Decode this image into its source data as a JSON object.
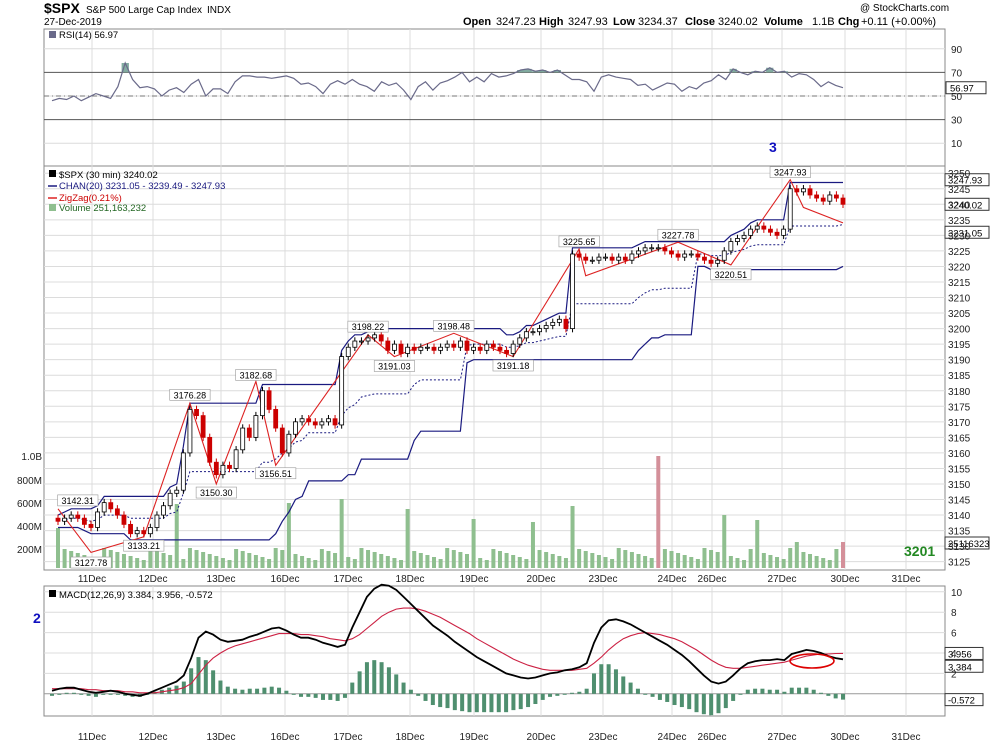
{
  "header": {
    "symbol": "$SPX",
    "name": "S&P 500 Large Cap Index",
    "exchange": "INDX",
    "date": "27-Dec-2019",
    "watermark": "@ StockCharts.com",
    "open_label": "Open",
    "open": "3247.23",
    "high_label": "High",
    "high": "3247.93",
    "low_label": "Low",
    "low": "3234.37",
    "close_label": "Close",
    "close": "3240.02",
    "volume_label": "Volume",
    "volume": "1.1B",
    "chg_label": "Chg",
    "chg": "+0.11 (+0.00%)"
  },
  "colors": {
    "up": "#000000",
    "down": "#cc0000",
    "channel": "#1a1a80",
    "zigzag": "#dd2222",
    "volume_bar": "#8fbf8f",
    "volume_bar_red": "#d4909a",
    "rsi_line": "#6a6a8a",
    "rsi_fill": "#6d9e90",
    "macd_line": "#000000",
    "signal_line": "#cc2244",
    "histogram": "#4f8f6f",
    "grid": "#dcdcdc",
    "blue_label": "#1010c0",
    "green_label": "#228822"
  },
  "chart_data": [
    {
      "type": "line",
      "panel": "RSI",
      "legend": "RSI(14) 56.97",
      "last_value": "56.97",
      "y_ticks": [
        "90",
        "70",
        "50",
        "30",
        "10"
      ],
      "levels": [
        70,
        30
      ],
      "ylim": [
        0,
        100
      ],
      "values": [
        46,
        48,
        47,
        50,
        46,
        49,
        52,
        50,
        48,
        58,
        78,
        64,
        57,
        58,
        56,
        50,
        55,
        57,
        53,
        60,
        64,
        50,
        56,
        56,
        52,
        62,
        67,
        67,
        66,
        66,
        65,
        66,
        67,
        65,
        60,
        61,
        58,
        52,
        60,
        63,
        60,
        64,
        60,
        58,
        54,
        62,
        59,
        61,
        55,
        47,
        58,
        62,
        55,
        61,
        63,
        66,
        70,
        62,
        66,
        62,
        69,
        66,
        67,
        69,
        72,
        73,
        71,
        72,
        70,
        72,
        68,
        64,
        64,
        62,
        54,
        66,
        68,
        66,
        65,
        64,
        59,
        60,
        55,
        58,
        61,
        60,
        54,
        58,
        56,
        61,
        63,
        68,
        64,
        73,
        70,
        68,
        71,
        70,
        74,
        70,
        71,
        66,
        69,
        68,
        64,
        58,
        62,
        59,
        57
      ]
    },
    {
      "type": "candlestick",
      "panel": "price",
      "legend": [
        "$SPX (30 min) 3240.02",
        "CHAN(20) 3231.05 - 3239.49 - 3247.93",
        "ZigZag(0.21%)",
        "Volume 251,163,232"
      ],
      "categories": [
        "11Dec",
        "12Dec",
        "13Dec",
        "16Dec",
        "17Dec",
        "18Dec",
        "19Dec",
        "20Dec",
        "23Dec",
        "24Dec",
        "26Dec",
        "27Dec",
        "30Dec",
        "31Dec"
      ],
      "y_ticks": [
        "3250",
        "3245",
        "3240",
        "3235",
        "3230",
        "3225",
        "3220",
        "3215",
        "3210",
        "3205",
        "3200",
        "3195",
        "3190",
        "3185",
        "3180",
        "3175",
        "3170",
        "3165",
        "3160",
        "3155",
        "3150",
        "3145",
        "3140",
        "3135",
        "3130",
        "3125"
      ],
      "ylim": [
        3122,
        3252
      ],
      "last_price": "3240.02",
      "channel_upper_label": "3247.93",
      "channel_lower_label": "3231.05",
      "closes": [
        3138,
        3139,
        3140,
        3139,
        3137,
        3136,
        3141,
        3144,
        3142,
        3140,
        3137,
        3134,
        3135,
        3134,
        3136,
        3140,
        3143,
        3147,
        3148,
        3160,
        3174,
        3172,
        3165,
        3157,
        3153,
        3156,
        3155,
        3161,
        3168,
        3165,
        3172,
        3180,
        3174,
        3168,
        3160,
        3166,
        3170,
        3171,
        3170,
        3169,
        3170,
        3171,
        3169,
        3191,
        3194,
        3196,
        3196,
        3197,
        3198,
        3196,
        3193,
        3195,
        3192,
        3194,
        3193,
        3194,
        3194,
        3193,
        3194,
        3195,
        3194,
        3196,
        3193,
        3194,
        3193,
        3195,
        3194,
        3193,
        3192,
        3195,
        3197,
        3199,
        3199,
        3200,
        3201,
        3202,
        3203,
        3200,
        3224,
        3223,
        3222,
        3222,
        3223,
        3223,
        3222,
        3223,
        3222,
        3224,
        3225,
        3226,
        3226,
        3226,
        3225,
        3224,
        3223,
        3224,
        3224,
        3223,
        3222,
        3221,
        3222,
        3225,
        3228,
        3229,
        3230,
        3232,
        3233,
        3232,
        3231,
        3230,
        3232,
        3245,
        3244,
        3245,
        3243,
        3242,
        3241,
        3243,
        3242,
        3240
      ],
      "volume_ticks": [
        "1.0B",
        "800M",
        "600M",
        "400M",
        "200M"
      ],
      "volume_label": "251163232",
      "annotations": [
        {
          "text": "3142.31"
        },
        {
          "text": "3127.78"
        },
        {
          "text": "3133.21"
        },
        {
          "text": "3176.28"
        },
        {
          "text": "3150.30"
        },
        {
          "text": "3182.68"
        },
        {
          "text": "3156.51"
        },
        {
          "text": "3198.22"
        },
        {
          "text": "3191.03"
        },
        {
          "text": "3198.48"
        },
        {
          "text": "3191.18"
        },
        {
          "text": "3225.65"
        },
        {
          "text": "3227.78"
        },
        {
          "text": "3220.51"
        },
        {
          "text": "3247.93"
        }
      ],
      "wave_label": "3",
      "target_label": "3201"
    },
    {
      "type": "line",
      "panel": "MACD",
      "legend": "MACD(12,26,9) 3.384, 3.956, -0.572",
      "y_ticks": [
        "10",
        "8",
        "6",
        "4",
        "2"
      ],
      "macd_flag": "3.384",
      "signal_flag": "3.956",
      "hist_flag": "-0.572",
      "wave_label": "2",
      "ylim": [
        -1.5,
        11
      ],
      "macd": [
        0.3,
        0.5,
        0.6,
        0.6,
        0.4,
        0.2,
        0.1,
        0.2,
        0.3,
        0.2,
        0.0,
        -0.1,
        -0.2,
        0.0,
        0.3,
        0.6,
        0.9,
        1.2,
        1.8,
        3.5,
        5.5,
        6.1,
        5.8,
        5.3,
        5.1,
        5.2,
        5.3,
        5.6,
        5.8,
        6.1,
        6.4,
        6.5,
        6.2,
        5.8,
        5.5,
        5.5,
        5.3,
        5.0,
        4.8,
        4.6,
        4.8,
        6.5,
        8.0,
        9.5,
        10.3,
        10.7,
        10.6,
        10.2,
        9.5,
        8.8,
        8.1,
        7.4,
        6.7,
        6.2,
        5.7,
        5.1,
        4.6,
        4.1,
        3.6,
        3.2,
        2.8,
        2.4,
        2.0,
        1.8,
        1.6,
        1.5,
        1.6,
        1.8,
        2.0,
        2.1,
        2.3,
        2.4,
        2.6,
        3.0,
        5.0,
        6.5,
        7.2,
        7.3,
        7.1,
        6.8,
        6.4,
        6.0,
        5.6,
        5.2,
        4.8,
        4.3,
        3.8,
        3.2,
        2.5,
        1.8,
        1.2,
        1.0,
        1.2,
        1.8,
        2.5,
        3.0,
        3.2,
        3.3,
        3.3,
        3.4,
        3.3,
        3.9,
        4.1,
        4.3,
        4.2,
        4.0,
        3.7,
        3.5,
        3.384
      ],
      "signal": [
        0.5,
        0.5,
        0.5,
        0.5,
        0.5,
        0.4,
        0.4,
        0.3,
        0.3,
        0.3,
        0.2,
        0.2,
        0.1,
        0.1,
        0.1,
        0.2,
        0.3,
        0.4,
        0.6,
        1.0,
        1.9,
        2.8,
        3.5,
        4.0,
        4.4,
        4.7,
        4.9,
        5.1,
        5.3,
        5.5,
        5.7,
        5.9,
        5.9,
        5.9,
        5.8,
        5.8,
        5.7,
        5.6,
        5.4,
        5.3,
        5.2,
        5.4,
        5.8,
        6.4,
        7.0,
        7.6,
        8.0,
        8.3,
        8.4,
        8.4,
        8.3,
        8.1,
        7.8,
        7.5,
        7.1,
        6.7,
        6.3,
        5.9,
        5.4,
        5.0,
        4.6,
        4.2,
        3.8,
        3.4,
        3.1,
        2.8,
        2.6,
        2.4,
        2.3,
        2.3,
        2.3,
        2.3,
        2.4,
        2.5,
        3.0,
        3.6,
        4.3,
        4.9,
        5.4,
        5.7,
        5.9,
        6.0,
        5.9,
        5.8,
        5.6,
        5.4,
        5.1,
        4.7,
        4.3,
        3.8,
        3.3,
        2.9,
        2.6,
        2.5,
        2.5,
        2.6,
        2.7,
        2.8,
        2.9,
        3.0,
        3.1,
        3.3,
        3.5,
        3.7,
        3.8,
        3.9,
        3.9,
        3.95,
        3.956
      ]
    }
  ],
  "x_axis_labels": [
    "11Dec",
    "12Dec",
    "13Dec",
    "16Dec",
    "17Dec",
    "18Dec",
    "19Dec",
    "20Dec",
    "23Dec",
    "24Dec",
    "26Dec",
    "27Dec",
    "30Dec",
    "31Dec"
  ]
}
